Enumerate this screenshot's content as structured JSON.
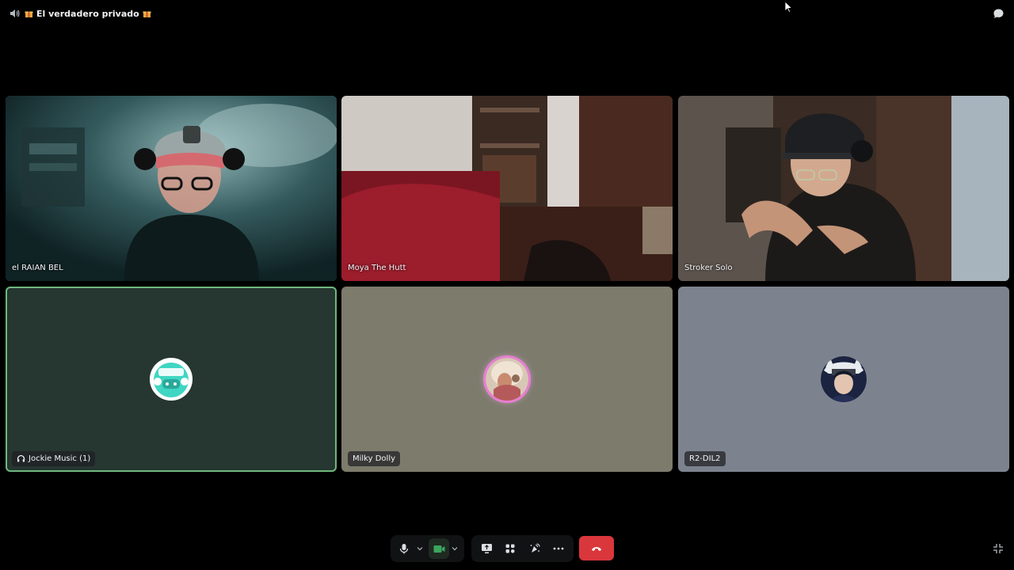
{
  "header": {
    "title": "El verdadero privado",
    "icons": [
      "speaker-icon",
      "gift-icon",
      "gift-icon",
      "chat-bubble-icon"
    ]
  },
  "participants": [
    {
      "name": "el RAIAN BEL",
      "type": "video",
      "speaking": true
    },
    {
      "name": "Moya The Hutt",
      "type": "video",
      "speaking": false
    },
    {
      "name": "Stroker Solo",
      "type": "video",
      "speaking": false
    },
    {
      "name": "Jockie Music (1)",
      "type": "avatar",
      "bg": "#263631",
      "speaking": true,
      "icon": "bot-headphones-icon"
    },
    {
      "name": "Milky Dolly",
      "type": "avatar",
      "bg": "#7c7b6c",
      "speaking": false
    },
    {
      "name": "R2-DIL2",
      "type": "avatar",
      "bg": "#7d838e",
      "speaking": false
    }
  ],
  "controls": {
    "icons": [
      "microphone-icon",
      "chevron-down-icon",
      "camera-icon",
      "chevron-down-icon",
      "screen-share-icon",
      "activities-icon",
      "soundboard-icon",
      "more-icon",
      "hang-up-icon",
      "fullscreen-exit-icon"
    ]
  },
  "colors": {
    "speaking_border": "#6fb87d",
    "hangup": "#da373c",
    "camera_on": "#3ba55d"
  }
}
